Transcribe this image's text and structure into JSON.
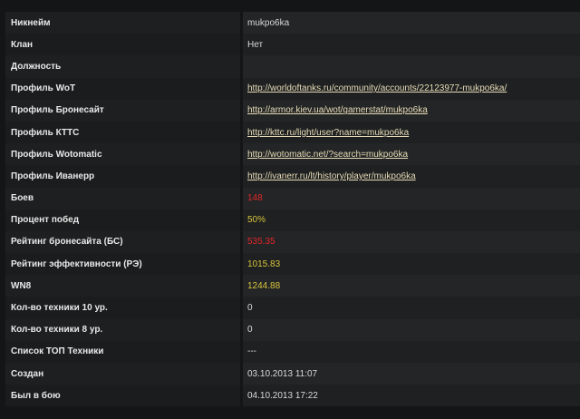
{
  "rows": [
    {
      "label": "Никнейм",
      "value": "mukpo6ka",
      "kind": "text"
    },
    {
      "label": "Клан",
      "value": "Нет",
      "kind": "text"
    },
    {
      "label": "Должность",
      "value": "",
      "kind": "text"
    },
    {
      "label": "Профиль WoT",
      "value": "http://worldoftanks.ru/community/accounts/22123977-mukpo6ka/",
      "kind": "link"
    },
    {
      "label": "Профиль Бронесайт",
      "value": "http://armor.kiev.ua/wot/gamerstat/mukpo6ka",
      "kind": "link"
    },
    {
      "label": "Профиль КТТС",
      "value": "http://kttc.ru/light/user?name=mukpo6ka",
      "kind": "link"
    },
    {
      "label": "Профиль Wotomatic",
      "value": "http://wotomatic.net/?search=mukpo6ka",
      "kind": "link"
    },
    {
      "label": "Профиль Иванерр",
      "value": "http://ivanerr.ru/lt/history/player/mukpo6ka",
      "kind": "link"
    },
    {
      "label": "Боев",
      "value": "148",
      "kind": "red"
    },
    {
      "label": "Процент побед",
      "value": "50%",
      "kind": "yellow"
    },
    {
      "label": "Рейтинг бронесайта (БС)",
      "value": "535.35",
      "kind": "red"
    },
    {
      "label": "Рейтинг эффективности (РЭ)",
      "value": "1015.83",
      "kind": "yellow"
    },
    {
      "label": "WN8",
      "value": "1244.88",
      "kind": "yellow"
    },
    {
      "label": "Кол-во техники 10 ур.",
      "value": "0",
      "kind": "text"
    },
    {
      "label": "Кол-во техники 8 ур.",
      "value": "0",
      "kind": "text"
    },
    {
      "label": "Список ТОП Техники",
      "value": "---",
      "kind": "text"
    },
    {
      "label": "Создан",
      "value": "03.10.2013 11:07",
      "kind": "text"
    },
    {
      "label": "Был в бою",
      "value": "04.10.2013 17:22",
      "kind": "text"
    }
  ],
  "colors": {
    "background": "#141516",
    "link": "#e6dcb8",
    "red": "#e0262a",
    "yellow": "#d6c53d"
  }
}
